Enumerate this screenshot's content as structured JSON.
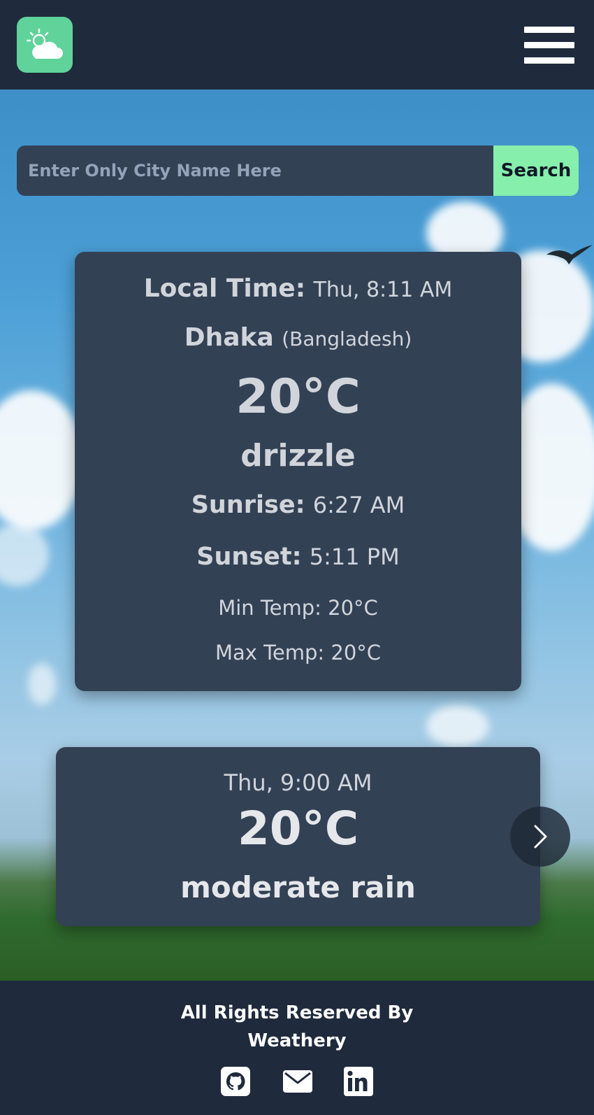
{
  "header": {
    "logo_icon": "cloud-sun-icon",
    "menu_icon": "hamburger-menu-icon"
  },
  "search": {
    "placeholder": "Enter Only City Name Here",
    "value": "",
    "button_label": "Search"
  },
  "current": {
    "local_time_label": "Local Time:",
    "local_time_value": "Thu, 8:11 AM",
    "city": "Dhaka",
    "country": "(Bangladesh)",
    "temperature": "20°C",
    "description": "drizzle",
    "sunrise_label": "Sunrise:",
    "sunrise_value": "6:27 AM",
    "sunset_label": "Sunset:",
    "sunset_value": "5:11 PM",
    "min_temp": "Min Temp: 20°C",
    "max_temp": "Max Temp: 20°C"
  },
  "forecast": {
    "items": [
      {
        "time": "Thu, 9:00 AM",
        "temperature": "20°C",
        "description": "moderate rain"
      }
    ],
    "next_icon": "chevron-right-icon"
  },
  "footer": {
    "line1": "All Rights Reserved By",
    "line2": "Weathery",
    "social_icons": [
      "github-icon",
      "mail-icon",
      "linkedin-icon"
    ]
  },
  "colors": {
    "header_bg": "#1f2a3c",
    "card_bg": "#334155",
    "accent": "#86efac",
    "logo_bg": "#5fd39a"
  }
}
